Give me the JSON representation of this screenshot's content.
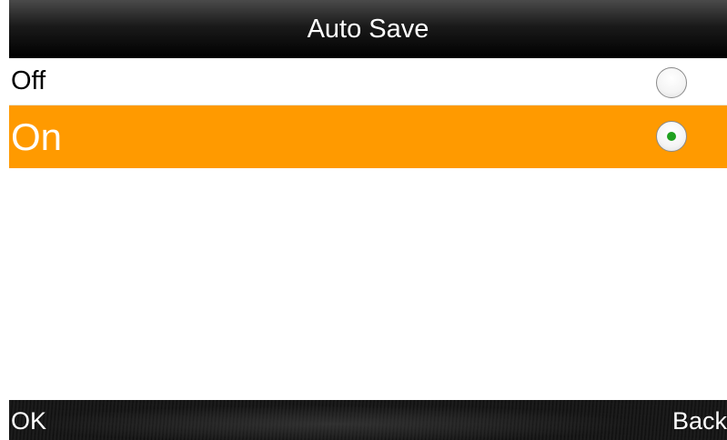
{
  "header": {
    "title": "Auto Save"
  },
  "options": [
    {
      "label": "Off",
      "selected": false
    },
    {
      "label": "On",
      "selected": true
    }
  ],
  "softkeys": {
    "left": "OK",
    "right": "Back"
  },
  "colors": {
    "highlight": "#ff9a00",
    "radio_selected_dot": "#1fa01f",
    "bar_background": "#000000"
  }
}
